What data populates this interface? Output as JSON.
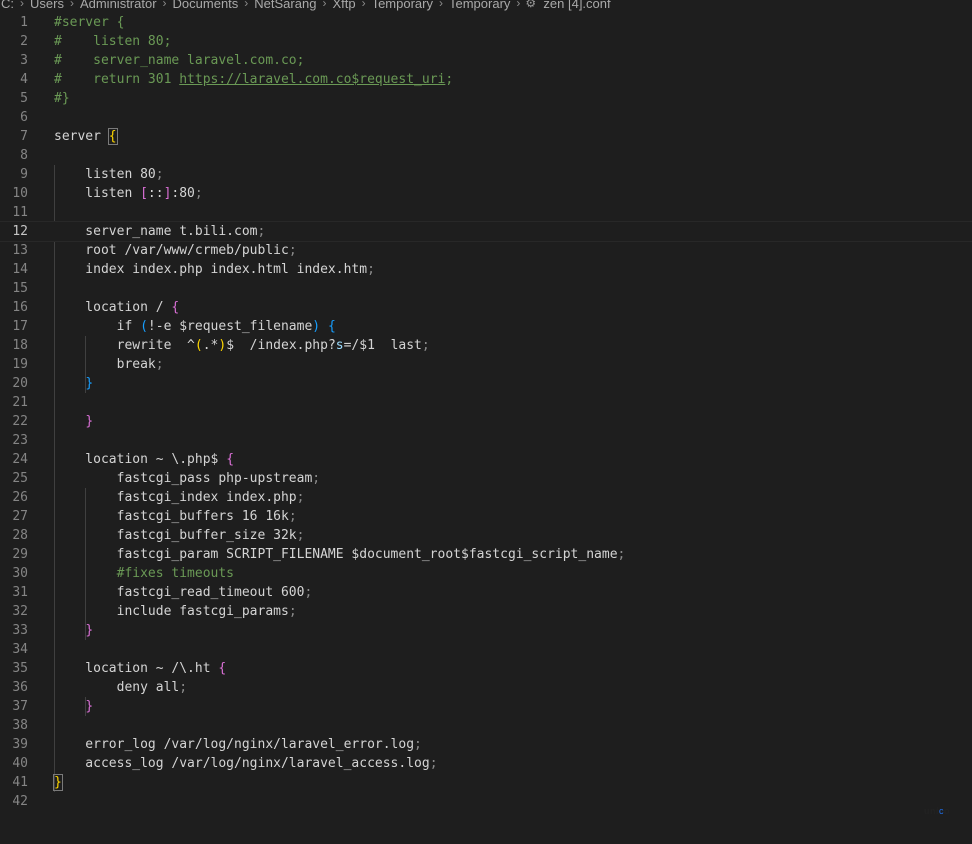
{
  "breadcrumb": [
    {
      "label": "C:"
    },
    {
      "label": "Users"
    },
    {
      "label": "Administrator"
    },
    {
      "label": "Documents"
    },
    {
      "label": "NetSarang"
    },
    {
      "label": "Xftp"
    },
    {
      "label": "Temporary"
    },
    {
      "label": "Temporary"
    },
    {
      "label": "zen [4].conf",
      "icon": "gear-icon"
    }
  ],
  "editor": {
    "current_line": 12,
    "lines": [
      {
        "n": "1",
        "t": [
          [
            "#server {",
            "cm"
          ]
        ]
      },
      {
        "n": "2",
        "t": [
          [
            "#    listen 80;",
            "cm"
          ]
        ]
      },
      {
        "n": "3",
        "t": [
          [
            "#    server_name laravel.com.co;",
            "cm"
          ]
        ]
      },
      {
        "n": "4",
        "t": [
          [
            "#    return 301 ",
            "cm"
          ],
          [
            "https://laravel.com.co$request_uri",
            "link"
          ],
          [
            ";",
            "cm"
          ]
        ]
      },
      {
        "n": "5",
        "t": [
          [
            "#}",
            "cm"
          ]
        ]
      },
      {
        "n": "6",
        "t": []
      },
      {
        "n": "7",
        "t": [
          [
            "server ",
            ""
          ],
          [
            "{",
            "br1 match"
          ]
        ]
      },
      {
        "n": "8",
        "t": []
      },
      {
        "n": "9",
        "t": [
          [
            "    listen 80",
            ""
          ],
          [
            ";",
            "pt"
          ]
        ]
      },
      {
        "n": "10",
        "t": [
          [
            "    listen ",
            ""
          ],
          [
            "[",
            "br2"
          ],
          [
            "::",
            ""
          ],
          [
            "]",
            "br2"
          ],
          [
            ":80",
            ""
          ],
          [
            ";",
            "pt"
          ]
        ]
      },
      {
        "n": "11",
        "t": []
      },
      {
        "n": "12",
        "t": [
          [
            "    server_name t.bili.com",
            ""
          ],
          [
            ";",
            "pt"
          ]
        ]
      },
      {
        "n": "13",
        "t": [
          [
            "    root /var/www/crmeb/public",
            ""
          ],
          [
            ";",
            "pt"
          ]
        ]
      },
      {
        "n": "14",
        "t": [
          [
            "    index index.php index.html index.htm",
            ""
          ],
          [
            ";",
            "pt"
          ]
        ]
      },
      {
        "n": "15",
        "t": []
      },
      {
        "n": "16",
        "t": [
          [
            "    location / ",
            ""
          ],
          [
            "{",
            "br2"
          ]
        ]
      },
      {
        "n": "17",
        "t": [
          [
            "        if ",
            ""
          ],
          [
            "(",
            "br3"
          ],
          [
            "!-e $request_filename",
            ""
          ],
          [
            ")",
            "br3"
          ],
          [
            " ",
            ""
          ],
          [
            "{",
            "br3"
          ]
        ]
      },
      {
        "n": "18",
        "t": [
          [
            "        rewrite  ^",
            ""
          ],
          [
            "(",
            "br1"
          ],
          [
            ".*",
            ""
          ],
          [
            ")",
            "br1"
          ],
          [
            "$  /index.php?",
            ""
          ],
          [
            "s",
            "var"
          ],
          [
            "=/$1  last",
            ""
          ],
          [
            ";",
            "pt"
          ]
        ]
      },
      {
        "n": "19",
        "t": [
          [
            "        break",
            ""
          ],
          [
            ";",
            "pt"
          ]
        ]
      },
      {
        "n": "20",
        "t": [
          [
            "    ",
            ""
          ],
          [
            "}",
            "br3"
          ]
        ]
      },
      {
        "n": "21",
        "t": []
      },
      {
        "n": "22",
        "t": [
          [
            "    ",
            ""
          ],
          [
            "}",
            "br2"
          ]
        ]
      },
      {
        "n": "23",
        "t": []
      },
      {
        "n": "24",
        "t": [
          [
            "    location ~ \\.php$ ",
            ""
          ],
          [
            "{",
            "br2"
          ]
        ]
      },
      {
        "n": "25",
        "t": [
          [
            "        fastcgi_pass php-upstream",
            ""
          ],
          [
            ";",
            "pt"
          ]
        ]
      },
      {
        "n": "26",
        "t": [
          [
            "        fastcgi_index index.php",
            ""
          ],
          [
            ";",
            "pt"
          ]
        ]
      },
      {
        "n": "27",
        "t": [
          [
            "        fastcgi_buffers 16 16k",
            ""
          ],
          [
            ";",
            "pt"
          ]
        ]
      },
      {
        "n": "28",
        "t": [
          [
            "        fastcgi_buffer_size 32k",
            ""
          ],
          [
            ";",
            "pt"
          ]
        ]
      },
      {
        "n": "29",
        "t": [
          [
            "        fastcgi_param SCRIPT_FILENAME $document_root$fastcgi_script_name",
            ""
          ],
          [
            ";",
            "pt"
          ]
        ]
      },
      {
        "n": "30",
        "t": [
          [
            "        #fixes timeouts",
            "cm"
          ]
        ]
      },
      {
        "n": "31",
        "t": [
          [
            "        fastcgi_read_timeout 600",
            ""
          ],
          [
            ";",
            "pt"
          ]
        ]
      },
      {
        "n": "32",
        "t": [
          [
            "        include fastcgi_params",
            ""
          ],
          [
            ";",
            "pt"
          ]
        ]
      },
      {
        "n": "33",
        "t": [
          [
            "    ",
            ""
          ],
          [
            "}",
            "br2"
          ]
        ]
      },
      {
        "n": "34",
        "t": []
      },
      {
        "n": "35",
        "t": [
          [
            "    location ~ /\\.ht ",
            ""
          ],
          [
            "{",
            "br2"
          ]
        ]
      },
      {
        "n": "36",
        "t": [
          [
            "        deny all",
            ""
          ],
          [
            ";",
            "pt"
          ]
        ]
      },
      {
        "n": "37",
        "t": [
          [
            "    ",
            ""
          ],
          [
            "}",
            "br2"
          ]
        ]
      },
      {
        "n": "38",
        "t": []
      },
      {
        "n": "39",
        "t": [
          [
            "    error_log /var/log/nginx/laravel_error.log",
            ""
          ],
          [
            ";",
            "pt"
          ]
        ]
      },
      {
        "n": "40",
        "t": [
          [
            "    access_log /var/log/nginx/laravel_access.log",
            ""
          ],
          [
            ";",
            "pt"
          ]
        ]
      },
      {
        "n": "41",
        "t": [
          [
            "}",
            "br1 match"
          ]
        ]
      },
      {
        "n": "42",
        "t": []
      }
    ]
  },
  "watermark": {
    "pre": "uni",
    "mid": "c",
    "post": "o"
  },
  "colors": {
    "background": "#1e1e1e",
    "text": "#d4d4d4",
    "comment": "#6a9955",
    "bracket_level1": "#ffd700",
    "bracket_level2": "#da70d6",
    "bracket_level3": "#179fff",
    "line_number": "#858585"
  }
}
